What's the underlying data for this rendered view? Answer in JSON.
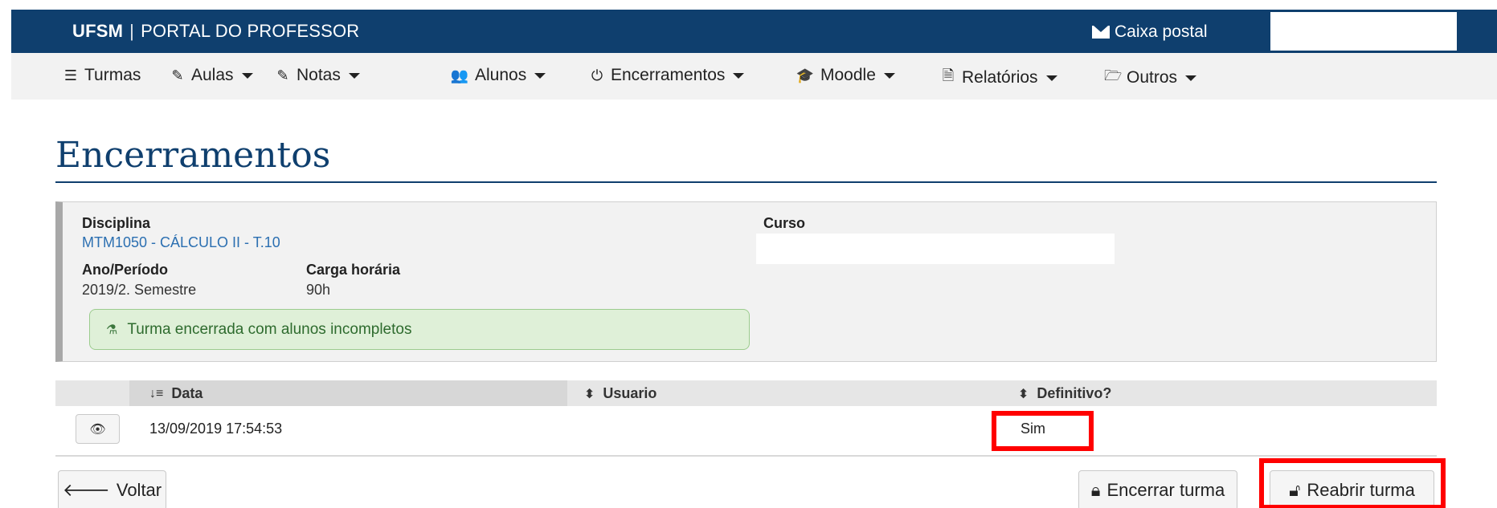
{
  "header": {
    "brand_name": "UFSM",
    "separator": "|",
    "portal_title": "PORTAL DO PROFESSOR",
    "mailbox_label": "Caixa postal",
    "mailbox_icon": "envelope-icon",
    "bar_color": "#0f3f6e"
  },
  "nav": {
    "items": [
      {
        "label": "Turmas",
        "icon": "list-icon",
        "dropdown": false
      },
      {
        "label": "Aulas",
        "icon": "pencil-icon",
        "dropdown": true
      },
      {
        "label": "Notas",
        "icon": "pencil-icon",
        "dropdown": true
      },
      {
        "label": "Alunos",
        "icon": "users-icon",
        "dropdown": true
      },
      {
        "label": "Encerramentos",
        "icon": "power-icon",
        "dropdown": true
      },
      {
        "label": "Moodle",
        "icon": "graduation-cap-icon",
        "dropdown": true
      },
      {
        "label": "Relatórios",
        "icon": "file-icon",
        "dropdown": true
      },
      {
        "label": "Outros",
        "icon": "folder-open-icon",
        "dropdown": true
      }
    ]
  },
  "page": {
    "title": "Encerramentos"
  },
  "info": {
    "disciplina_label": "Disciplina",
    "disciplina_value": "MTM1050 - CÁLCULO II - T.10",
    "curso_label": "Curso",
    "ano_label": "Ano/Período",
    "ano_value": "2019/2. Semestre",
    "carga_label": "Carga horária",
    "carga_value": "90h",
    "alert_text": "Turma encerrada com alunos incompletos",
    "alert_icon": "flask-icon"
  },
  "table": {
    "columns": [
      "Data",
      "Usuario",
      "Definitivo?"
    ],
    "rows": [
      {
        "data": "13/09/2019 17:54:53",
        "usuario": "",
        "definitivo": "Sim"
      }
    ]
  },
  "actions": {
    "back_label": "Voltar",
    "close_label": "Encerrar turma",
    "reopen_label": "Reabrir turma",
    "highlight_color": "#ff0000"
  }
}
